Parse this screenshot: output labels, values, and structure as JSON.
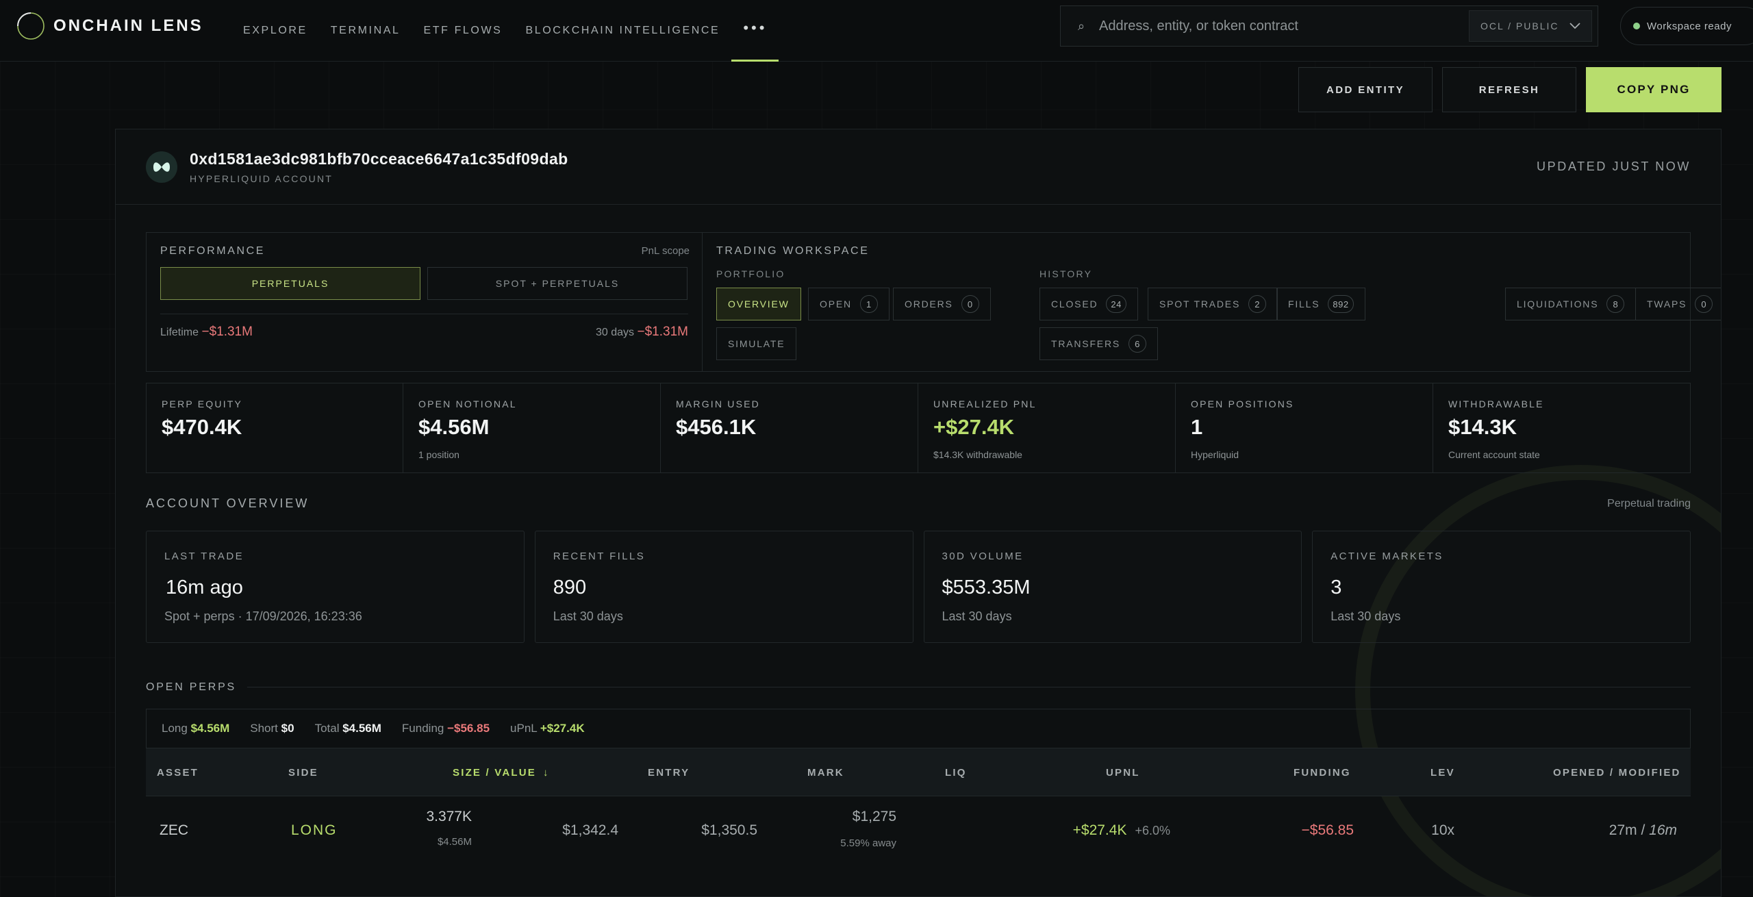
{
  "brand": {
    "name": "ONCHAIN LENS"
  },
  "nav": {
    "items": [
      "EXPLORE",
      "TERMINAL",
      "ETF FLOWS",
      "BLOCKCHAIN INTELLIGENCE"
    ],
    "more": "•••"
  },
  "search": {
    "placeholder": "Address, entity, or token contract",
    "scope": "OCL / PUBLIC"
  },
  "status": {
    "text": "Workspace ready"
  },
  "actions": {
    "add": "ADD ENTITY",
    "refresh": "REFRESH",
    "copy": "COPY PNG"
  },
  "account": {
    "address": "0xd1581ae3dc981bfb70cceace6647a1c35df09dab",
    "type": "HYPERLIQUID ACCOUNT",
    "updated": "UPDATED JUST NOW"
  },
  "performance": {
    "title": "PERFORMANCE",
    "scope_label": "PnL scope",
    "tabs": [
      "PERPETUALS",
      "SPOT + PERPETUALS"
    ],
    "lifetime_label": "Lifetime",
    "lifetime_value": "−$1.31M",
    "d30_label": "30 days",
    "d30_value": "−$1.31M"
  },
  "workspace": {
    "title": "TRADING WORKSPACE",
    "portfolio_label": "PORTFOLIO",
    "history_label": "HISTORY",
    "portfolio": [
      {
        "label": "OVERVIEW",
        "count": ""
      },
      {
        "label": "OPEN",
        "count": "1"
      },
      {
        "label": "ORDERS",
        "count": "0"
      },
      {
        "label": "SIMULATE",
        "count": ""
      }
    ],
    "history": [
      {
        "label": "CLOSED",
        "count": "24"
      },
      {
        "label": "SPOT TRADES",
        "count": "2"
      },
      {
        "label": "FILLS",
        "count": "892"
      },
      {
        "label": "LIQUIDATIONS",
        "count": "8"
      },
      {
        "label": "TWAPS",
        "count": "0"
      },
      {
        "label": "TRANSFERS",
        "count": "6"
      }
    ]
  },
  "metrics": [
    {
      "label": "PERP EQUITY",
      "value": "$470.4K",
      "sub": ""
    },
    {
      "label": "OPEN NOTIONAL",
      "value": "$4.56M",
      "sub": "1 position"
    },
    {
      "label": "MARGIN USED",
      "value": "$456.1K",
      "sub": ""
    },
    {
      "label": "UNREALIZED PNL",
      "value": "+$27.4K",
      "sub": "$14.3K withdrawable"
    },
    {
      "label": "OPEN POSITIONS",
      "value": "1",
      "sub": "Hyperliquid"
    },
    {
      "label": "WITHDRAWABLE",
      "value": "$14.3K",
      "sub": "Current account state"
    }
  ],
  "overview": {
    "title": "ACCOUNT OVERVIEW",
    "right": "Perpetual trading",
    "cards": [
      {
        "label": "LAST TRADE",
        "value": "16m ago",
        "sub": "Spot + perps · 17/09/2026, 16:23:36"
      },
      {
        "label": "RECENT FILLS",
        "value": "890",
        "sub": "Last 30 days"
      },
      {
        "label": "30D VOLUME",
        "value": "$553.35M",
        "sub": "Last 30 days"
      },
      {
        "label": "ACTIVE MARKETS",
        "value": "3",
        "sub": "Last 30 days"
      }
    ]
  },
  "open_perps": {
    "title": "OPEN PERPS",
    "summary": {
      "long_label": "Long",
      "long": "$4.56M",
      "short_label": "Short",
      "short": "$0",
      "total_label": "Total",
      "total": "$4.56M",
      "funding_label": "Funding",
      "funding": "−$56.85",
      "upnl_label": "uPnL",
      "upnl": "+$27.4K"
    },
    "columns": [
      "ASSET",
      "SIDE",
      "SIZE / VALUE",
      "ENTRY",
      "MARK",
      "LIQ",
      "UPNL",
      "FUNDING",
      "LEV",
      "OPENED / MODIFIED"
    ],
    "sort_arrow": "↓",
    "rows": [
      {
        "asset": "ZEC",
        "side": "LONG",
        "size": "3.377K",
        "value": "$4.56M",
        "entry": "$1,342.4",
        "mark": "$1,350.5",
        "liq": "$1,275",
        "liq_away": "5.59% away",
        "upnl": "+$27.4K",
        "upnl_pct": "+6.0%",
        "funding": "−$56.85",
        "lev": "10x",
        "opened": "27m",
        "modified": "16m"
      }
    ]
  },
  "colors": {
    "accent": "#b8dd6d",
    "negative": "#e9797a",
    "background": "#0b0d0e"
  }
}
